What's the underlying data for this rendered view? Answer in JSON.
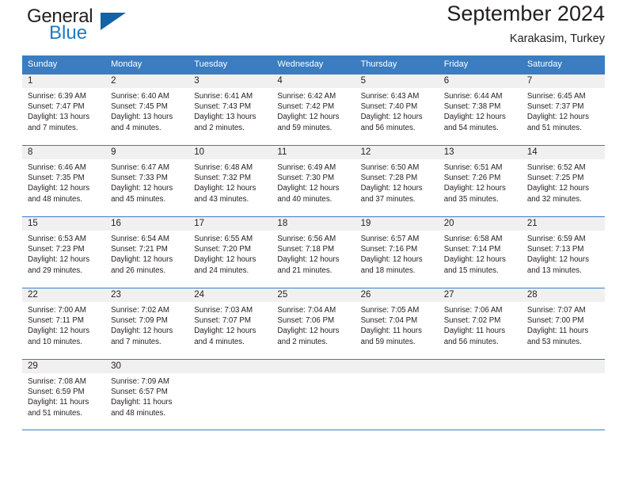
{
  "brand": {
    "name_part1": "General",
    "name_part2": "Blue"
  },
  "header": {
    "title": "September 2024",
    "subtitle": "Karakasim, Turkey"
  },
  "weekday_headers": [
    "Sunday",
    "Monday",
    "Tuesday",
    "Wednesday",
    "Thursday",
    "Friday",
    "Saturday"
  ],
  "colors": {
    "header_blue": "#3b7dc0",
    "logo_blue": "#1262a8",
    "daynum_band": "#f0f0f0",
    "text": "#231f20"
  },
  "weeks": [
    [
      {
        "day": "1",
        "sunrise": "Sunrise: 6:39 AM",
        "sunset": "Sunset: 7:47 PM",
        "daylight1": "Daylight: 13 hours",
        "daylight2": "and 7 minutes."
      },
      {
        "day": "2",
        "sunrise": "Sunrise: 6:40 AM",
        "sunset": "Sunset: 7:45 PM",
        "daylight1": "Daylight: 13 hours",
        "daylight2": "and 4 minutes."
      },
      {
        "day": "3",
        "sunrise": "Sunrise: 6:41 AM",
        "sunset": "Sunset: 7:43 PM",
        "daylight1": "Daylight: 13 hours",
        "daylight2": "and 2 minutes."
      },
      {
        "day": "4",
        "sunrise": "Sunrise: 6:42 AM",
        "sunset": "Sunset: 7:42 PM",
        "daylight1": "Daylight: 12 hours",
        "daylight2": "and 59 minutes."
      },
      {
        "day": "5",
        "sunrise": "Sunrise: 6:43 AM",
        "sunset": "Sunset: 7:40 PM",
        "daylight1": "Daylight: 12 hours",
        "daylight2": "and 56 minutes."
      },
      {
        "day": "6",
        "sunrise": "Sunrise: 6:44 AM",
        "sunset": "Sunset: 7:38 PM",
        "daylight1": "Daylight: 12 hours",
        "daylight2": "and 54 minutes."
      },
      {
        "day": "7",
        "sunrise": "Sunrise: 6:45 AM",
        "sunset": "Sunset: 7:37 PM",
        "daylight1": "Daylight: 12 hours",
        "daylight2": "and 51 minutes."
      }
    ],
    [
      {
        "day": "8",
        "sunrise": "Sunrise: 6:46 AM",
        "sunset": "Sunset: 7:35 PM",
        "daylight1": "Daylight: 12 hours",
        "daylight2": "and 48 minutes."
      },
      {
        "day": "9",
        "sunrise": "Sunrise: 6:47 AM",
        "sunset": "Sunset: 7:33 PM",
        "daylight1": "Daylight: 12 hours",
        "daylight2": "and 45 minutes."
      },
      {
        "day": "10",
        "sunrise": "Sunrise: 6:48 AM",
        "sunset": "Sunset: 7:32 PM",
        "daylight1": "Daylight: 12 hours",
        "daylight2": "and 43 minutes."
      },
      {
        "day": "11",
        "sunrise": "Sunrise: 6:49 AM",
        "sunset": "Sunset: 7:30 PM",
        "daylight1": "Daylight: 12 hours",
        "daylight2": "and 40 minutes."
      },
      {
        "day": "12",
        "sunrise": "Sunrise: 6:50 AM",
        "sunset": "Sunset: 7:28 PM",
        "daylight1": "Daylight: 12 hours",
        "daylight2": "and 37 minutes."
      },
      {
        "day": "13",
        "sunrise": "Sunrise: 6:51 AM",
        "sunset": "Sunset: 7:26 PM",
        "daylight1": "Daylight: 12 hours",
        "daylight2": "and 35 minutes."
      },
      {
        "day": "14",
        "sunrise": "Sunrise: 6:52 AM",
        "sunset": "Sunset: 7:25 PM",
        "daylight1": "Daylight: 12 hours",
        "daylight2": "and 32 minutes."
      }
    ],
    [
      {
        "day": "15",
        "sunrise": "Sunrise: 6:53 AM",
        "sunset": "Sunset: 7:23 PM",
        "daylight1": "Daylight: 12 hours",
        "daylight2": "and 29 minutes."
      },
      {
        "day": "16",
        "sunrise": "Sunrise: 6:54 AM",
        "sunset": "Sunset: 7:21 PM",
        "daylight1": "Daylight: 12 hours",
        "daylight2": "and 26 minutes."
      },
      {
        "day": "17",
        "sunrise": "Sunrise: 6:55 AM",
        "sunset": "Sunset: 7:20 PM",
        "daylight1": "Daylight: 12 hours",
        "daylight2": "and 24 minutes."
      },
      {
        "day": "18",
        "sunrise": "Sunrise: 6:56 AM",
        "sunset": "Sunset: 7:18 PM",
        "daylight1": "Daylight: 12 hours",
        "daylight2": "and 21 minutes."
      },
      {
        "day": "19",
        "sunrise": "Sunrise: 6:57 AM",
        "sunset": "Sunset: 7:16 PM",
        "daylight1": "Daylight: 12 hours",
        "daylight2": "and 18 minutes."
      },
      {
        "day": "20",
        "sunrise": "Sunrise: 6:58 AM",
        "sunset": "Sunset: 7:14 PM",
        "daylight1": "Daylight: 12 hours",
        "daylight2": "and 15 minutes."
      },
      {
        "day": "21",
        "sunrise": "Sunrise: 6:59 AM",
        "sunset": "Sunset: 7:13 PM",
        "daylight1": "Daylight: 12 hours",
        "daylight2": "and 13 minutes."
      }
    ],
    [
      {
        "day": "22",
        "sunrise": "Sunrise: 7:00 AM",
        "sunset": "Sunset: 7:11 PM",
        "daylight1": "Daylight: 12 hours",
        "daylight2": "and 10 minutes."
      },
      {
        "day": "23",
        "sunrise": "Sunrise: 7:02 AM",
        "sunset": "Sunset: 7:09 PM",
        "daylight1": "Daylight: 12 hours",
        "daylight2": "and 7 minutes."
      },
      {
        "day": "24",
        "sunrise": "Sunrise: 7:03 AM",
        "sunset": "Sunset: 7:07 PM",
        "daylight1": "Daylight: 12 hours",
        "daylight2": "and 4 minutes."
      },
      {
        "day": "25",
        "sunrise": "Sunrise: 7:04 AM",
        "sunset": "Sunset: 7:06 PM",
        "daylight1": "Daylight: 12 hours",
        "daylight2": "and 2 minutes."
      },
      {
        "day": "26",
        "sunrise": "Sunrise: 7:05 AM",
        "sunset": "Sunset: 7:04 PM",
        "daylight1": "Daylight: 11 hours",
        "daylight2": "and 59 minutes."
      },
      {
        "day": "27",
        "sunrise": "Sunrise: 7:06 AM",
        "sunset": "Sunset: 7:02 PM",
        "daylight1": "Daylight: 11 hours",
        "daylight2": "and 56 minutes."
      },
      {
        "day": "28",
        "sunrise": "Sunrise: 7:07 AM",
        "sunset": "Sunset: 7:00 PM",
        "daylight1": "Daylight: 11 hours",
        "daylight2": "and 53 minutes."
      }
    ],
    [
      {
        "day": "29",
        "sunrise": "Sunrise: 7:08 AM",
        "sunset": "Sunset: 6:59 PM",
        "daylight1": "Daylight: 11 hours",
        "daylight2": "and 51 minutes."
      },
      {
        "day": "30",
        "sunrise": "Sunrise: 7:09 AM",
        "sunset": "Sunset: 6:57 PM",
        "daylight1": "Daylight: 11 hours",
        "daylight2": "and 48 minutes."
      },
      {
        "day": "",
        "sunrise": "",
        "sunset": "",
        "daylight1": "",
        "daylight2": ""
      },
      {
        "day": "",
        "sunrise": "",
        "sunset": "",
        "daylight1": "",
        "daylight2": ""
      },
      {
        "day": "",
        "sunrise": "",
        "sunset": "",
        "daylight1": "",
        "daylight2": ""
      },
      {
        "day": "",
        "sunrise": "",
        "sunset": "",
        "daylight1": "",
        "daylight2": ""
      },
      {
        "day": "",
        "sunrise": "",
        "sunset": "",
        "daylight1": "",
        "daylight2": ""
      }
    ]
  ]
}
